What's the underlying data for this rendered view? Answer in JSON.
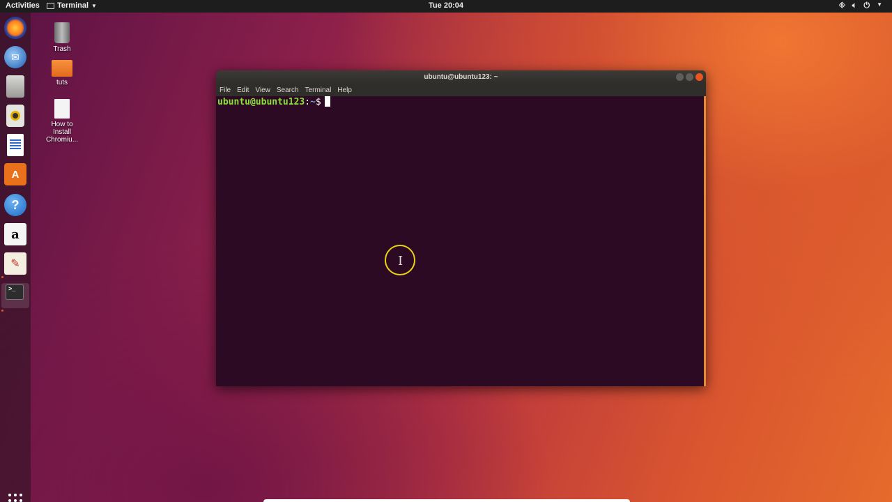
{
  "topbar": {
    "activities": "Activities",
    "app_menu": "Terminal",
    "clock": "Tue 20:04"
  },
  "desktop": {
    "icons": [
      {
        "label": "Trash"
      },
      {
        "label": "tuts"
      },
      {
        "label": "How to Install Chromiu..."
      }
    ]
  },
  "dock": {
    "items": [
      "firefox-icon",
      "thunderbird-icon",
      "files-icon",
      "rhythmbox-icon",
      "libreoffice-writer-icon",
      "software-center-icon",
      "help-icon",
      "amazon-icon",
      "text-editor-icon",
      "terminal-icon"
    ],
    "show_apps": "show-applications-icon"
  },
  "terminal": {
    "title": "ubuntu@ubuntu123: ~",
    "menu": [
      "File",
      "Edit",
      "View",
      "Search",
      "Terminal",
      "Help"
    ],
    "prompt_user": "ubuntu@ubuntu123",
    "prompt_sep": ":",
    "prompt_path": "~",
    "prompt_symbol": "$"
  },
  "colors": {
    "terminal_bg": "#2c0a24",
    "prompt_user": "#8ae234",
    "prompt_path": "#729fcf",
    "accent": "#e95420",
    "cursor_ring": "#e6d314"
  }
}
